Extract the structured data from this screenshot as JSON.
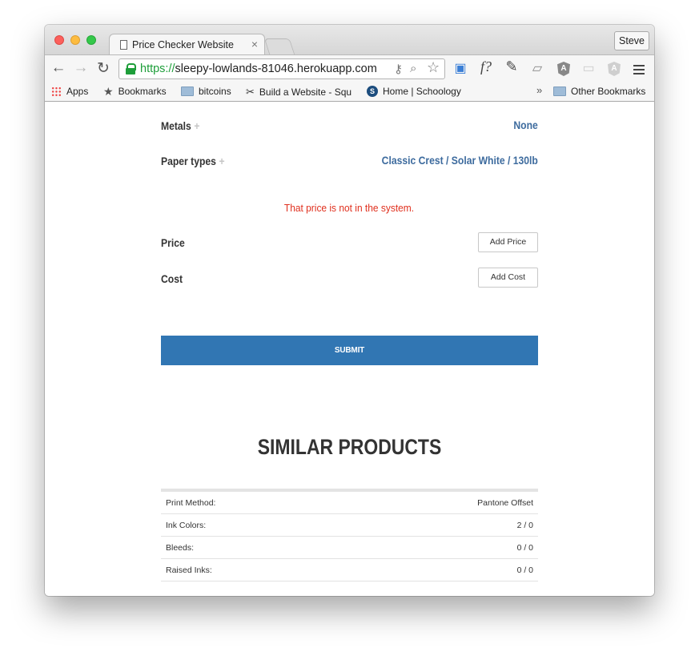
{
  "browser": {
    "tab_title": "Price Checker Website",
    "tab_close": "×",
    "profile": "Steve",
    "url_scheme": "https://",
    "url_rest": "sleepy-lowlands-81046.herokuapp.com",
    "ext_f": "f?",
    "ng_letter": "A"
  },
  "bookmarks": {
    "items": [
      {
        "label": "Apps"
      },
      {
        "label": "Bookmarks"
      },
      {
        "label": "bitcoins"
      },
      {
        "label": "Build a Website - Squ"
      },
      {
        "label": "Home | Schoology"
      }
    ],
    "overflow": "»",
    "other": "Other Bookmarks"
  },
  "form": {
    "metals_label": "Metals",
    "metals_value": "None",
    "paper_label": "Paper types",
    "paper_value": "Classic Crest / Solar White / 130lb",
    "plus": "+",
    "error": "That price is not in the system.",
    "price_label": "Price",
    "add_price": "Add Price",
    "cost_label": "Cost",
    "add_cost": "Add Cost",
    "submit": "SUBMIT"
  },
  "similar": {
    "title": "SIMILAR PRODUCTS",
    "rows": [
      {
        "key": "Print Method:",
        "value": "Pantone Offset"
      },
      {
        "key": "Ink Colors:",
        "value": "2 / 0"
      },
      {
        "key": "Bleeds:",
        "value": "0 / 0"
      },
      {
        "key": "Raised Inks:",
        "value": "0 / 0"
      }
    ]
  }
}
